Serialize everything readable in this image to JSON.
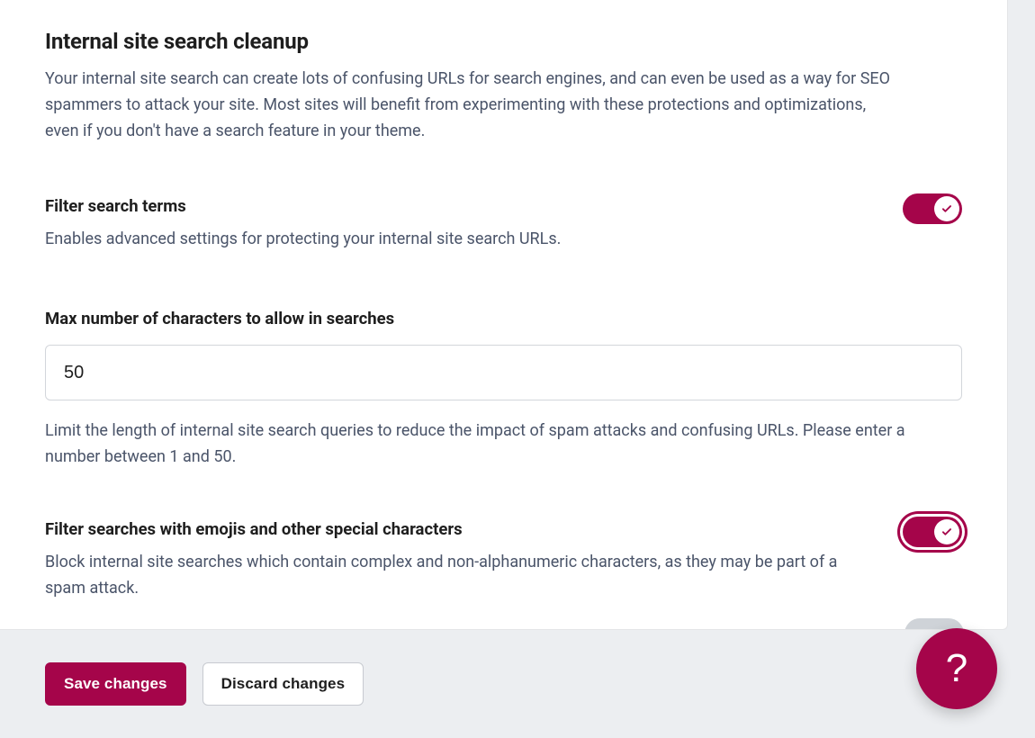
{
  "colors": {
    "accent": "#a5054a",
    "text": "#1e1e1e",
    "muted": "#4a5469",
    "panel": "#ffffff",
    "page_bg": "#eceef1"
  },
  "section": {
    "title": "Internal site search cleanup",
    "description": "Your internal site search can create lots of confusing URLs for search engines, and can even be used as a way for SEO spammers to attack your site. Most sites will benefit from experimenting with these protections and optimizations, even if you don't have a search feature in your theme."
  },
  "settings": {
    "filter_search_terms": {
      "label": "Filter search terms",
      "help": "Enables advanced settings for protecting your internal site search URLs.",
      "enabled": true
    },
    "max_chars": {
      "label": "Max number of characters to allow in searches",
      "value": "50",
      "help": "Limit the length of internal site search queries to reduce the impact of spam attacks and confusing URLs. Please enter a number between 1 and 50."
    },
    "filter_emoji": {
      "label": "Filter searches with emojis and other special characters",
      "help": "Block internal site searches which contain complex and non-alphanumeric characters, as they may be part of a spam attack.",
      "enabled": true,
      "focused": true
    }
  },
  "footer": {
    "save_label": "Save changes",
    "discard_label": "Discard changes"
  },
  "help_fab": {
    "label": "?"
  }
}
